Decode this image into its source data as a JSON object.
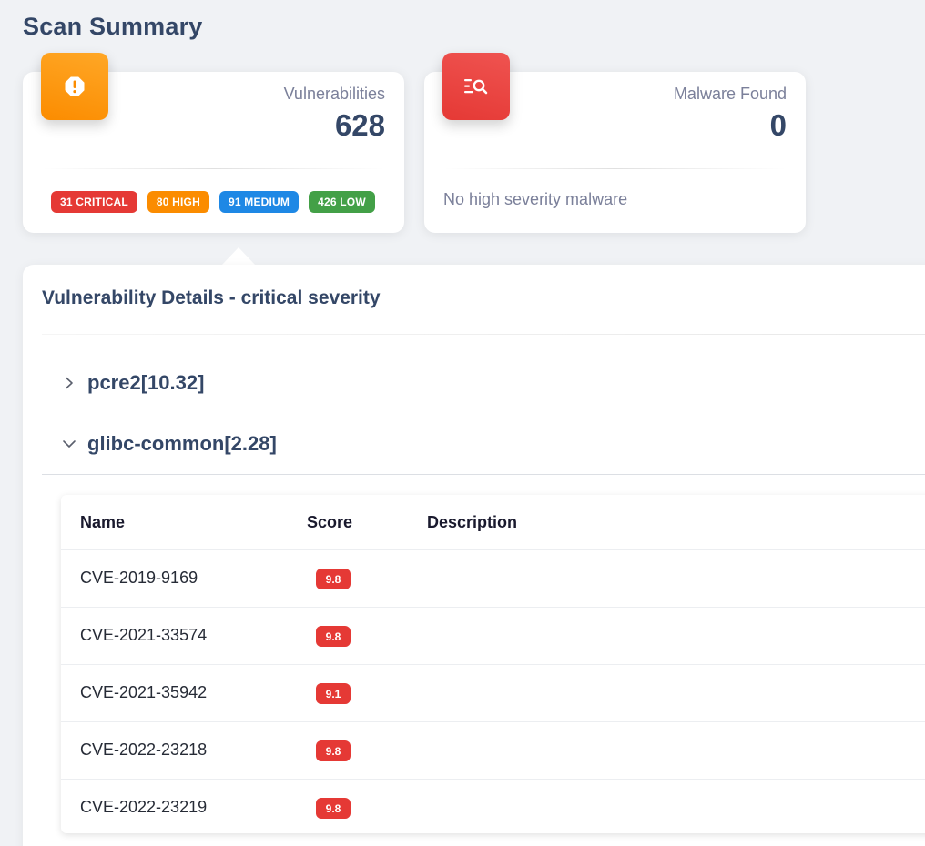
{
  "page": {
    "title": "Scan Summary"
  },
  "vulnerabilities_card": {
    "label": "Vulnerabilities",
    "value": "628",
    "icon": "alert-octagon-icon",
    "accent": "#fb8c00",
    "badges": [
      {
        "text": "31 CRITICAL",
        "color": "#e53935"
      },
      {
        "text": "80 HIGH",
        "color": "#fb8c00"
      },
      {
        "text": "91 MEDIUM",
        "color": "#1e88e5"
      },
      {
        "text": "426 LOW",
        "color": "#43a047"
      }
    ]
  },
  "malware_card": {
    "label": "Malware Found",
    "value": "0",
    "icon": "list-search-icon",
    "accent": "#e53935",
    "note": "No high severity malware"
  },
  "details": {
    "title": "Vulnerability Details - critical severity",
    "packages": [
      {
        "name": "pcre2[10.32]",
        "expanded": false
      },
      {
        "name": "glibc-common[2.28]",
        "expanded": true
      }
    ],
    "table": {
      "headers": {
        "name": "Name",
        "score": "Score",
        "description": "Description"
      },
      "rows": [
        {
          "name": "CVE-2019-9169",
          "score": "9.8",
          "description": ""
        },
        {
          "name": "CVE-2021-33574",
          "score": "9.8",
          "description": ""
        },
        {
          "name": "CVE-2021-35942",
          "score": "9.1",
          "description": ""
        },
        {
          "name": "CVE-2022-23218",
          "score": "9.8",
          "description": ""
        },
        {
          "name": "CVE-2022-23219",
          "score": "9.8",
          "description": ""
        }
      ]
    }
  }
}
